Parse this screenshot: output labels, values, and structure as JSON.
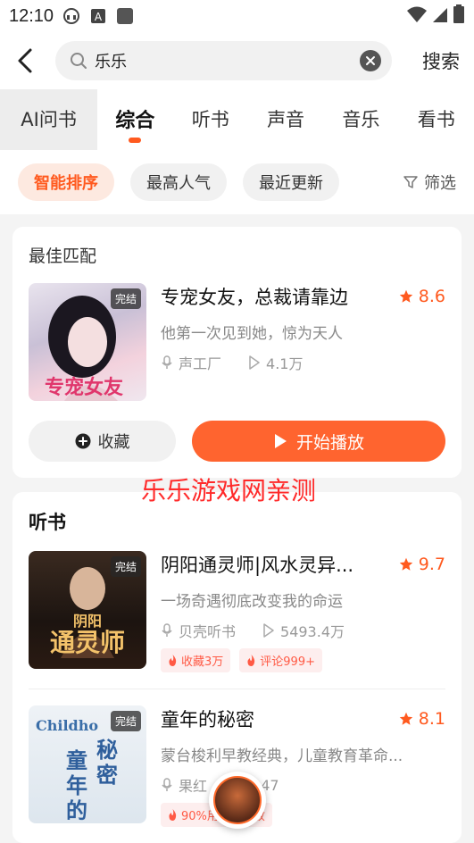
{
  "status": {
    "time": "12:10"
  },
  "search": {
    "value": "乐乐",
    "submit_label": "搜索"
  },
  "tabs": [
    {
      "label": "AI问书"
    },
    {
      "label": "综合"
    },
    {
      "label": "听书"
    },
    {
      "label": "声音"
    },
    {
      "label": "音乐"
    },
    {
      "label": "看书"
    }
  ],
  "filters": {
    "chips": [
      {
        "label": "智能排序"
      },
      {
        "label": "最高人气"
      },
      {
        "label": "最近更新"
      }
    ],
    "filter_label": "筛选"
  },
  "best_match": {
    "section_title": "最佳匹配",
    "item": {
      "cover_tag": "完结",
      "title": "专宠女友，总裁请靠边",
      "rating": "8.6",
      "desc": "他第一次见到她，惊为天人",
      "author": "声工厂",
      "plays": "4.1万"
    },
    "fav_label": "收藏",
    "play_label": "开始播放"
  },
  "watermark": "乐乐游戏网亲测",
  "audiobooks": {
    "section_title": "听书",
    "items": [
      {
        "cover_tag": "完结",
        "title": "阴阳通灵师|风水灵异...",
        "rating": "9.7",
        "desc": "一场奇遇彻底改变我的命运",
        "author": "贝壳听书",
        "plays": "5493.4万",
        "badges": [
          "收藏3万",
          "评论999+"
        ]
      },
      {
        "cover_tag": "完结",
        "title": "童年的秘密",
        "rating": "8.1",
        "desc": "蒙台梭利早教经典，儿童教育革命...",
        "author": "果红",
        "plays": "147",
        "badges": [
          "90%用户在播放"
        ]
      }
    ]
  },
  "colors": {
    "accent": "#ff5a1f",
    "play_button": "#ff642f"
  }
}
